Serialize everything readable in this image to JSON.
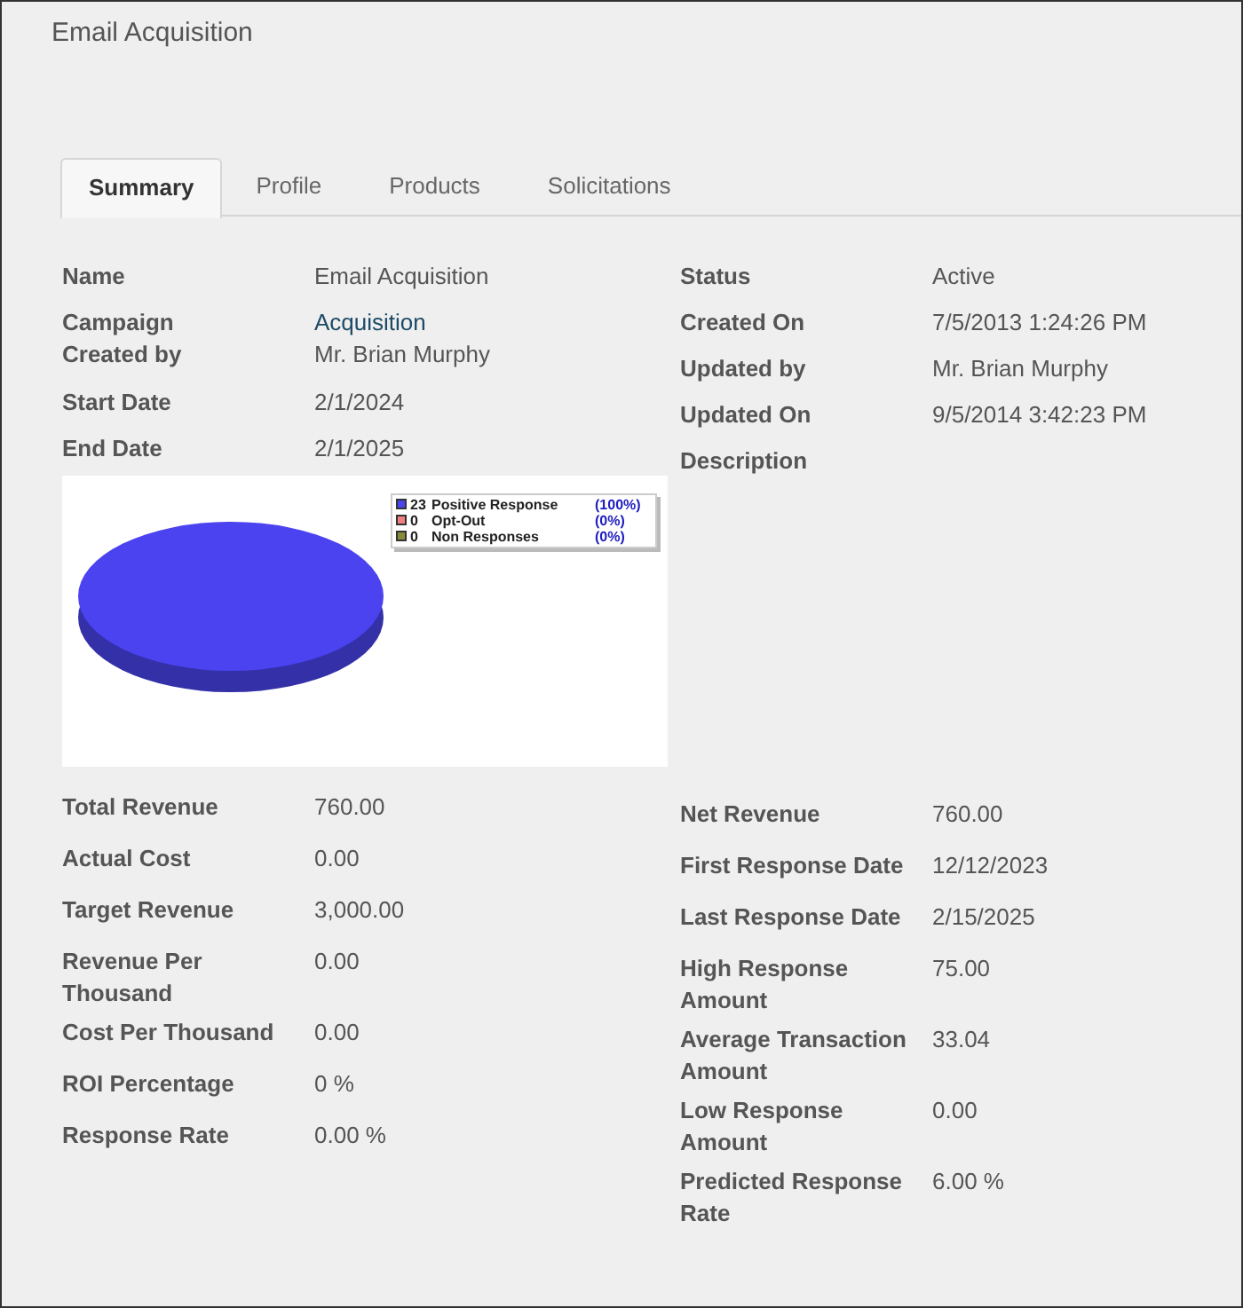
{
  "title": "Email Acquisition",
  "tabs": [
    {
      "label": "Summary",
      "selected": true
    },
    {
      "label": "Profile",
      "selected": false
    },
    {
      "label": "Products",
      "selected": false
    },
    {
      "label": "Solicitations",
      "selected": false
    }
  ],
  "left_top": [
    {
      "label": "Name",
      "value": "Email Acquisition",
      "kind": "text"
    },
    {
      "label": "Campaign",
      "value": "Acquisition",
      "kind": "link"
    },
    {
      "label": "Created by",
      "value": "Mr. Brian Murphy",
      "kind": "tight"
    },
    {
      "label": "Start Date",
      "value": "2/1/2024",
      "kind": "text"
    },
    {
      "label": "End Date",
      "value": "2/1/2025",
      "kind": "text"
    }
  ],
  "chart": {
    "legend": [
      {
        "count": "23",
        "percent": "(100%)",
        "color": "#4b42f0"
      },
      {
        "count": "0",
        "percent": "(0%)",
        "color": "#f08080"
      },
      {
        "count": "0",
        "percent": "(0%)",
        "color": "#8a8a3a"
      }
    ],
    "chart_data": {
      "type": "pie",
      "categories": [
        "Positive Response",
        "Opt-Out",
        "Non Responses"
      ],
      "values": [
        100,
        0,
        0
      ]
    }
  },
  "left_bottom": [
    {
      "label": "Total Revenue",
      "value": "760.00"
    },
    {
      "label": "Actual Cost",
      "value": "0.00"
    },
    {
      "label": "Target Revenue",
      "value": "3,000.00"
    },
    {
      "label": "Revenue Per Thousand",
      "value": "0.00"
    },
    {
      "label": "Cost Per Thousand",
      "value": "0.00"
    },
    {
      "label": "ROI Percentage",
      "value": "0 %"
    },
    {
      "label": "Response Rate",
      "value": "0.00 %"
    }
  ],
  "right_top": [
    {
      "label": "Status",
      "value": "Active"
    },
    {
      "label": "Created On",
      "value": "7/5/2013 1:24:26 PM"
    },
    {
      "label": "Updated by",
      "value": "Mr. Brian Murphy"
    },
    {
      "label": "Updated On",
      "value": "9/5/2014 3:42:23 PM"
    },
    {
      "label": "Description"
    }
  ],
  "right_bottom": [
    {
      "label": "Net Revenue",
      "value": "760.00"
    },
    {
      "label": "First Response Date",
      "value": "12/12/2023"
    },
    {
      "label": "Last Response Date",
      "value": "2/15/2025"
    },
    {
      "label": "High Response Amount",
      "value": "75.00"
    },
    {
      "label": "Average Transaction Amount",
      "value": "33.04"
    },
    {
      "label": "Low Response Amount",
      "value": "0.00"
    },
    {
      "label": "Predicted Response Rate",
      "value": "6.00 %"
    }
  ]
}
